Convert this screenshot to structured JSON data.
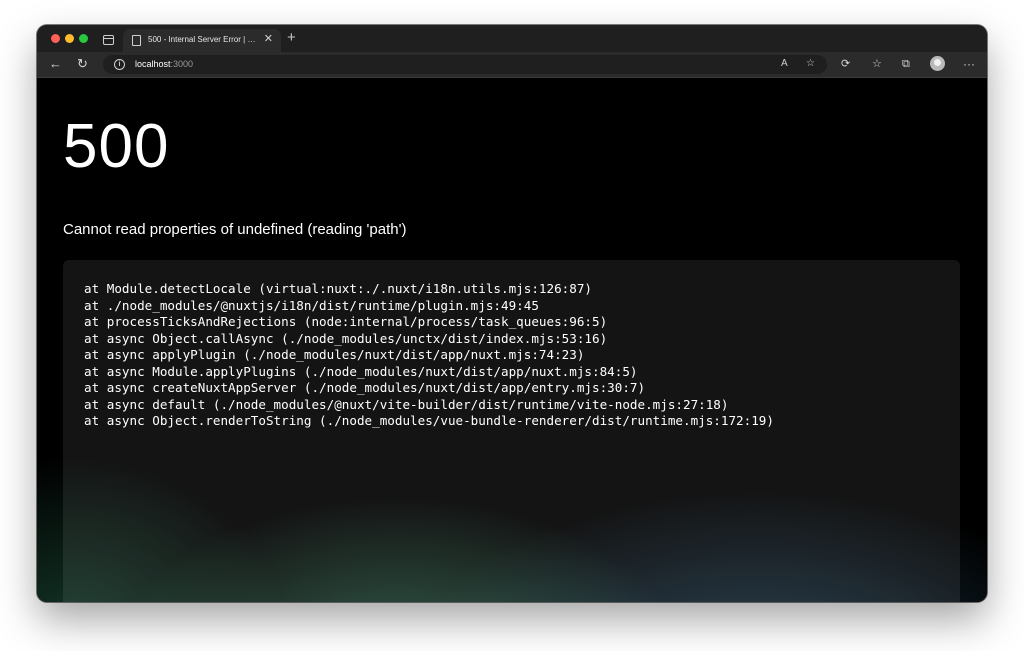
{
  "browser": {
    "tab_title": "500 - Internal Server Error | N…",
    "tab_close": "✕",
    "new_tab": "+",
    "url_host": "localhost",
    "url_port": ":3000",
    "icons": [
      "back-arrow-icon",
      "refresh-icon",
      "site-info-icon",
      "read-aloud-icon",
      "add-favorite-icon",
      "extensions-icon",
      "favorites-icon",
      "collections-icon",
      "profile-icon",
      "more-icon"
    ]
  },
  "page": {
    "status_code": "500",
    "message": "Cannot read properties of undefined (reading 'path')",
    "stack": [
      "at Module.detectLocale (virtual:nuxt:./.nuxt/i18n.utils.mjs:126:87)",
      "at ./node_modules/@nuxtjs/i18n/dist/runtime/plugin.mjs:49:45",
      "at processTicksAndRejections (node:internal/process/task_queues:96:5)",
      "at async Object.callAsync (./node_modules/unctx/dist/index.mjs:53:16)",
      "at async applyPlugin (./node_modules/nuxt/dist/app/nuxt.mjs:74:23)",
      "at async Module.applyPlugins (./node_modules/nuxt/dist/app/nuxt.mjs:84:5)",
      "at async createNuxtAppServer (./node_modules/nuxt/dist/app/entry.mjs:30:7)",
      "at async default (./node_modules/@nuxt/vite-builder/dist/runtime/vite-node.mjs:27:18)",
      "at async Object.renderToString (./node_modules/vue-bundle-renderer/dist/runtime.mjs:172:19)"
    ]
  }
}
